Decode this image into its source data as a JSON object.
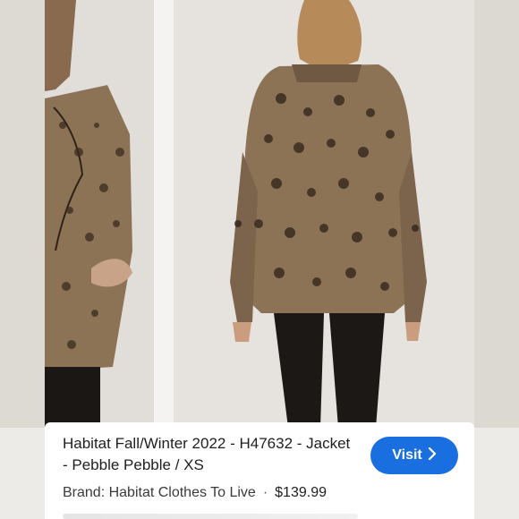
{
  "product": {
    "title": "Habitat Fall/Winter 2022 - H47632 - Jacket - Pebble Pebble / XS",
    "brand": "Brand: Habitat Clothes To Live",
    "separator": "·",
    "price": "$139.99"
  },
  "actions": {
    "visit_label": "Visit",
    "visit_icon": "chevron-right-icon"
  },
  "colors": {
    "accent": "#1a6fe0",
    "background": "#ecebe8"
  }
}
